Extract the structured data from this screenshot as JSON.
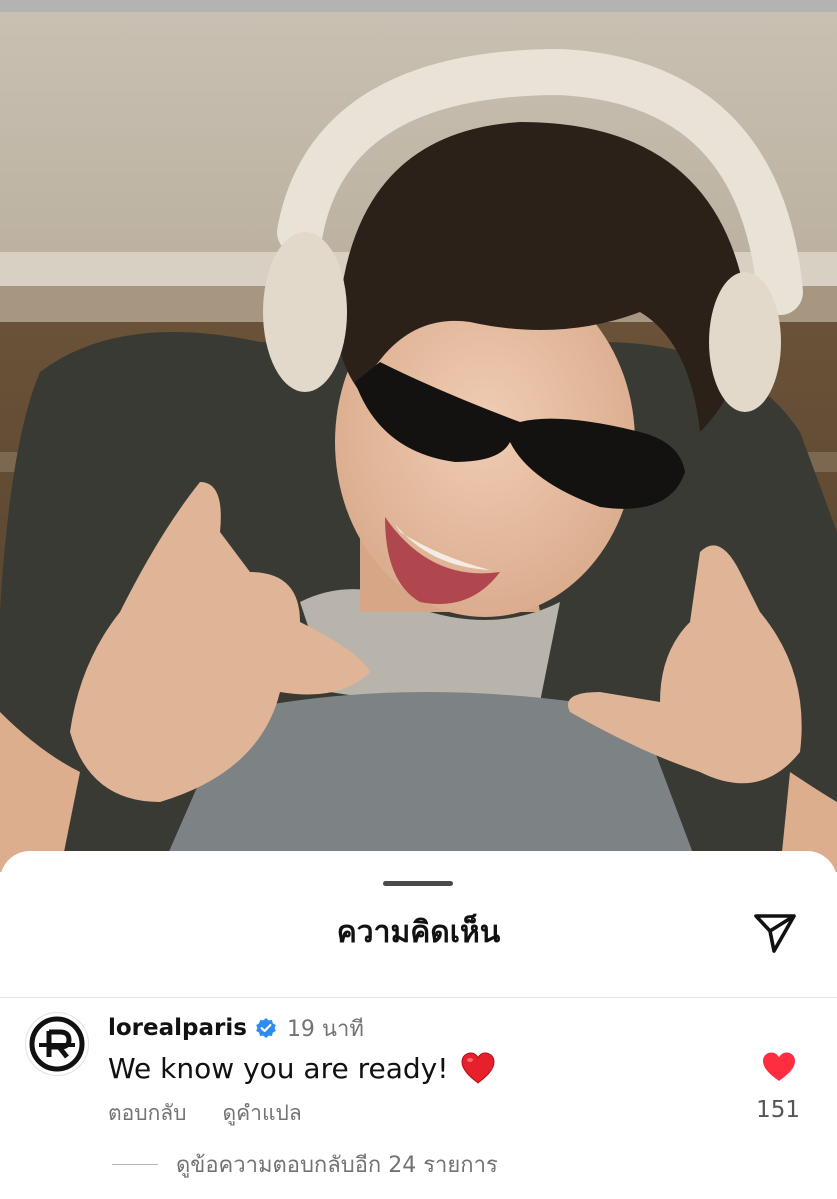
{
  "sheet": {
    "title": "ความคิดเห็น"
  },
  "comment": {
    "username": "lorealparis",
    "verified": true,
    "timestamp": "19 นาที",
    "text": "We know you are ready!",
    "emoji": "red-heart",
    "reply_label": "ตอบกลับ",
    "translate_label": "ดูคำแปล",
    "like_count": "151",
    "liked": true
  },
  "replies": {
    "label": "ดูข้อความตอบกลับอีก 24 รายการ"
  },
  "colors": {
    "like_red": "#ff2d3f",
    "verified_blue": "#2d8cf0",
    "secondary_text": "#737373"
  },
  "icons": {
    "share": "paper-plane-icon",
    "verified": "verified-badge-icon",
    "like": "heart-icon",
    "avatar": "loreal-logo"
  }
}
